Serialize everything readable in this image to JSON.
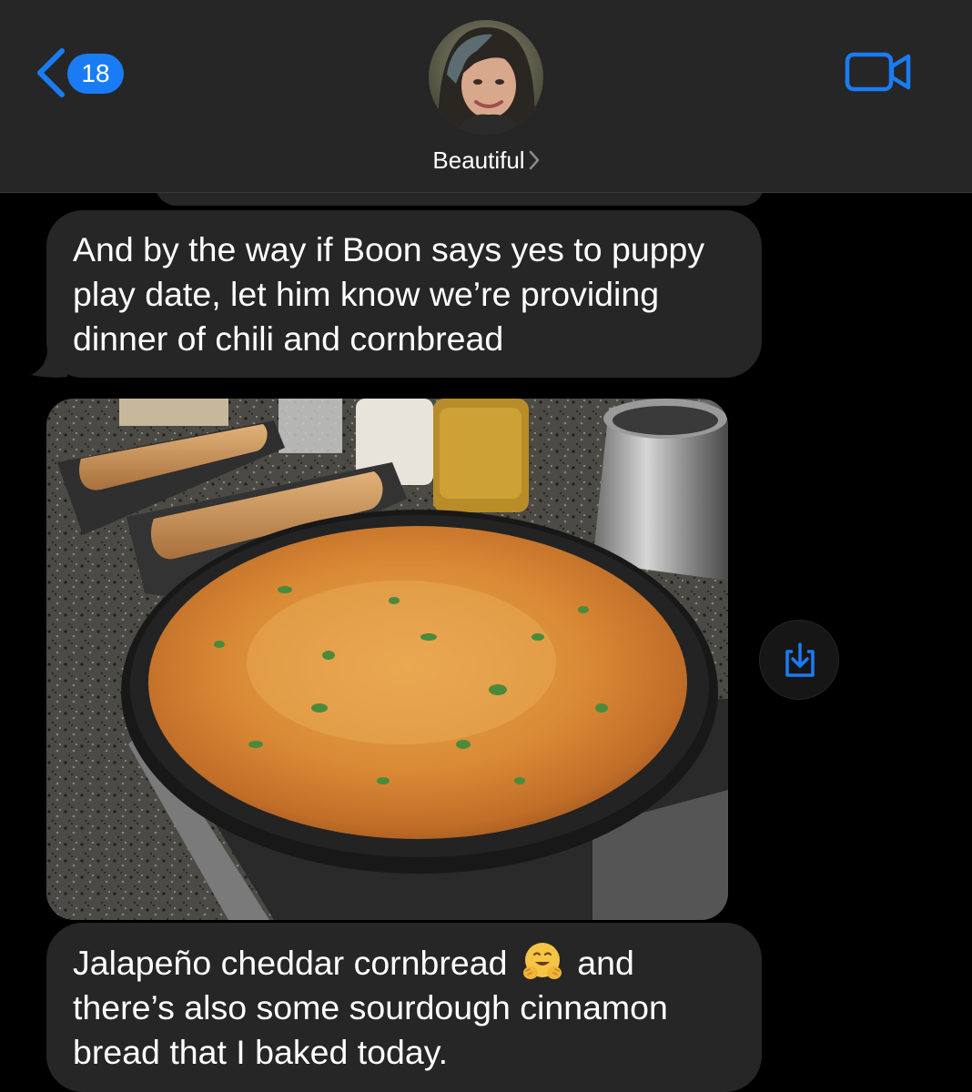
{
  "header": {
    "unread_count": "18",
    "contact_name": "Beautiful",
    "back_icon": "chevron-left-icon",
    "video_icon": "video-camera-icon",
    "accent_color": "#1a7cf5"
  },
  "messages": [
    {
      "type": "text",
      "direction": "incoming",
      "text": "And by the way if Boon says yes to puppy play date, let him know we’re providing dinner of chili and cornbread"
    },
    {
      "type": "image",
      "direction": "incoming",
      "content": "photo",
      "action_icon": "save-to-photos-icon"
    },
    {
      "type": "text",
      "direction": "incoming",
      "text_before_emoji": "Jalapeño cheddar cornbread",
      "emoji": "hugging-face-emoji",
      "text_after_emoji": "and there’s also some sourdough cinnamon bread that I baked today."
    }
  ],
  "colors": {
    "background": "#000000",
    "bubble_incoming": "#262626",
    "header_bg": "#262626",
    "text": "#ffffff"
  }
}
